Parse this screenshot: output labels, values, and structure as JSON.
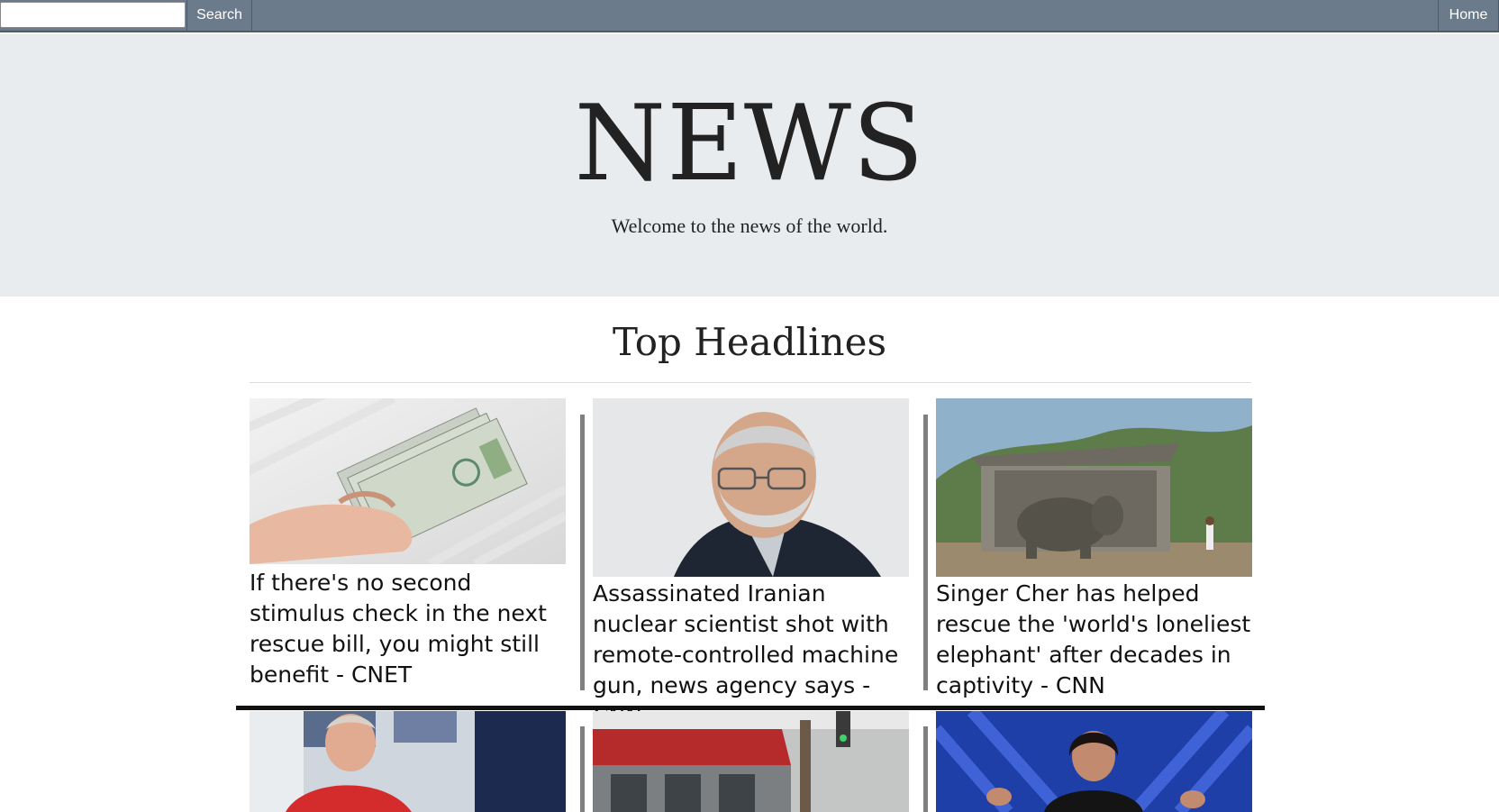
{
  "nav": {
    "search_placeholder": "",
    "search_value": "",
    "search_label": "Search",
    "home_label": "Home"
  },
  "hero": {
    "title": "NEWS",
    "subtitle": "Welcome to the news of the world."
  },
  "section": {
    "title": "Top Headlines"
  },
  "articles": [
    {
      "headline": "If there's no second stimulus check in the next rescue bill, you might still benefit - CNET",
      "image": "cash-in-hand-photo"
    },
    {
      "headline": "Assassinated Iranian nuclear scientist shot with remote-controlled machine gun, news agency says - CNN",
      "image": "scientist-portrait-photo"
    },
    {
      "headline": "Singer Cher has helped rescue the 'world's loneliest elephant' after decades in captivity - CNN",
      "image": "elephant-enclosure-photo"
    },
    {
      "headline": "",
      "image": "man-red-shirt-photo"
    },
    {
      "headline": "",
      "image": "storefront-street-photo"
    },
    {
      "headline": "",
      "image": "speaker-stage-photo"
    }
  ],
  "colors": {
    "nav_bg": "#6c7b8b",
    "hero_bg": "#e9ecef",
    "text": "#222222",
    "divider": "#808080"
  }
}
